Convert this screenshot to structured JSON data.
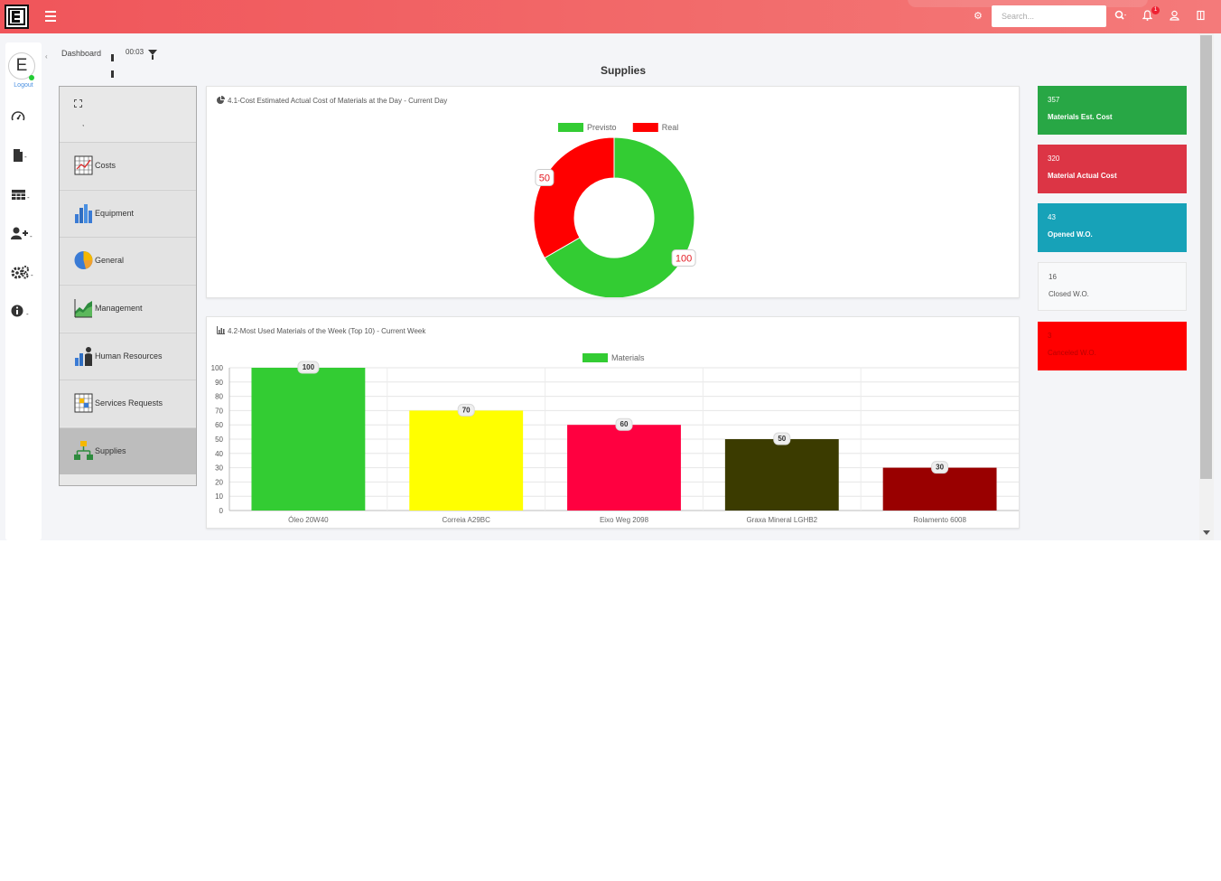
{
  "topbar": {
    "search_placeholder": "Search...",
    "notification_count": "1",
    "icons": [
      "menu-icon",
      "gear-icon",
      "search-icon",
      "bell-icon",
      "user-icon",
      "exit-icon"
    ]
  },
  "sidebar": {
    "avatar_letter": "E",
    "logout_label": "Logout",
    "icons": [
      "dashboard-gauge-icon",
      "document-icon",
      "table-icon",
      "add-user-icon",
      "settings-gears-icon",
      "info-icon"
    ]
  },
  "breadcrumb": {
    "label": "Dashboard",
    "timer": "00:03"
  },
  "page": {
    "title": "Supplies"
  },
  "categories": [
    {
      "label": "Costs",
      "icon": "costs-grid-icon"
    },
    {
      "label": "Equipment",
      "icon": "equipment-bars-icon"
    },
    {
      "label": "General",
      "icon": "general-pie-icon"
    },
    {
      "label": "Management",
      "icon": "management-area-icon"
    },
    {
      "label": "Human Resources",
      "icon": "human-resources-icon"
    },
    {
      "label": "Services Requests",
      "icon": "services-grid-icon"
    },
    {
      "label": "Supplies",
      "icon": "supplies-hierarchy-icon",
      "active": true
    }
  ],
  "chart1": {
    "title": "4.1-Cost Estimated Actual Cost of Materials at the Day - Current Day"
  },
  "chart2": {
    "title": "4.2-Most Used Materials of the Week (Top 10) - Current Week"
  },
  "chart_data": [
    {
      "type": "pie",
      "title": "4.1-Cost Estimated Actual Cost of Materials at the Day - Current Day",
      "donut": true,
      "legend_position": "top",
      "series": [
        {
          "name": "Previsto",
          "value": 100,
          "color": "#33cc33"
        },
        {
          "name": "Real",
          "value": 50,
          "color": "#ff0000"
        }
      ]
    },
    {
      "type": "bar",
      "title": "4.2-Most Used Materials of the Week (Top 10) - Current Week",
      "legend_position": "top",
      "grid": true,
      "categories": [
        "Óleo 20W40",
        "Correia A29BC",
        "Eixo Weg 2098",
        "Graxa Mineral LGHB2",
        "Rolamento 6008"
      ],
      "series": [
        {
          "name": "Materials",
          "values": [
            100,
            70,
            60,
            50,
            30
          ]
        }
      ],
      "colors": [
        "#33cc33",
        "#ffff00",
        "#ff0040",
        "#3b3b00",
        "#990000"
      ],
      "legend_color": "#33cc33",
      "ylim": [
        0,
        100
      ],
      "yticks": [
        0,
        10,
        20,
        30,
        40,
        50,
        60,
        70,
        80,
        90,
        100
      ]
    }
  ],
  "kpis": [
    {
      "value": "357",
      "label": "Materials Est. Cost",
      "color": "#28a745"
    },
    {
      "value": "320",
      "label": "Material Actual Cost",
      "color": "#dc3545"
    },
    {
      "value": "43",
      "label": "Opened W.O.",
      "color": "#17a2b8"
    },
    {
      "value": "16",
      "label": "Closed W.O.",
      "color": "#f8f9fa"
    },
    {
      "value": "3",
      "label": "Canceled W.O.",
      "color": "#ff0000"
    }
  ]
}
